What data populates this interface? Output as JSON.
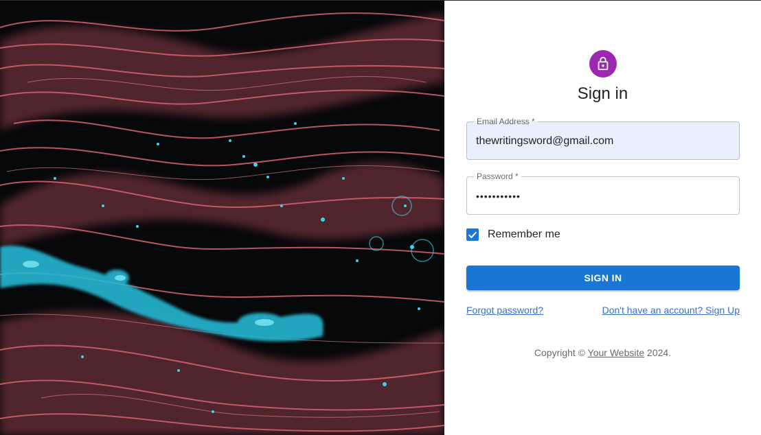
{
  "form": {
    "title": "Sign in",
    "email": {
      "label": "Email Address *",
      "value": "thewritingsword@gmail.com"
    },
    "password": {
      "label": "Password *",
      "value": "•••••••••••"
    },
    "remember": {
      "label": "Remember me",
      "checked": true
    },
    "submit_label": "SIGN IN",
    "forgot_label": "Forgot password?",
    "signup_label": "Don't have an account? Sign Up"
  },
  "footer": {
    "prefix": "Copyright © ",
    "site": "Your Website",
    "suffix": " 2024."
  },
  "colors": {
    "avatar": "#9c27b0",
    "primary": "#1976d2",
    "link": "#3a6fc4",
    "autofill": "#e8f0fe"
  },
  "icons": {
    "avatar": "lock-outlined-icon",
    "checkbox": "check-icon"
  }
}
